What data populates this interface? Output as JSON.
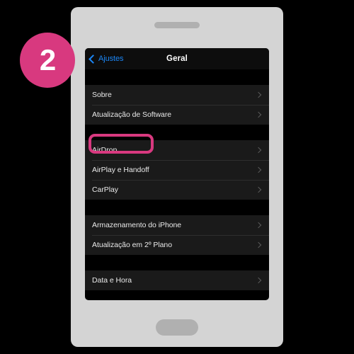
{
  "step_badge": {
    "number": "2",
    "color": "#d8397f"
  },
  "device": {
    "frame_color": "#d4d4d4",
    "accessory_color": "#b0b0b0",
    "earpiece_name": "earpiece-speaker",
    "home_button_name": "home-button"
  },
  "screen": {
    "navbar": {
      "back_label": "Ajustes",
      "back_color": "#1b87f7",
      "title": "Geral"
    },
    "highlight": {
      "target": "Sobre",
      "color": "#d8397f"
    },
    "sections": [
      {
        "rows": [
          {
            "label": "Sobre",
            "chevron": "chevron-right-icon",
            "highlighted": true
          },
          {
            "label": "Atualização de Software",
            "chevron": "chevron-right-icon",
            "highlighted": false
          }
        ]
      },
      {
        "rows": [
          {
            "label": "AirDrop",
            "chevron": "chevron-right-icon",
            "highlighted": false
          },
          {
            "label": "AirPlay e Handoff",
            "chevron": "chevron-right-icon",
            "highlighted": false
          },
          {
            "label": "CarPlay",
            "chevron": "chevron-right-icon",
            "highlighted": false
          }
        ]
      },
      {
        "rows": [
          {
            "label": "Armazenamento do iPhone",
            "chevron": "chevron-right-icon",
            "highlighted": false
          },
          {
            "label": "Atualização em 2º Plano",
            "chevron": "chevron-right-icon",
            "highlighted": false
          }
        ]
      },
      {
        "rows": [
          {
            "label": "Data e Hora",
            "chevron": "chevron-right-icon",
            "highlighted": false
          }
        ]
      }
    ]
  }
}
